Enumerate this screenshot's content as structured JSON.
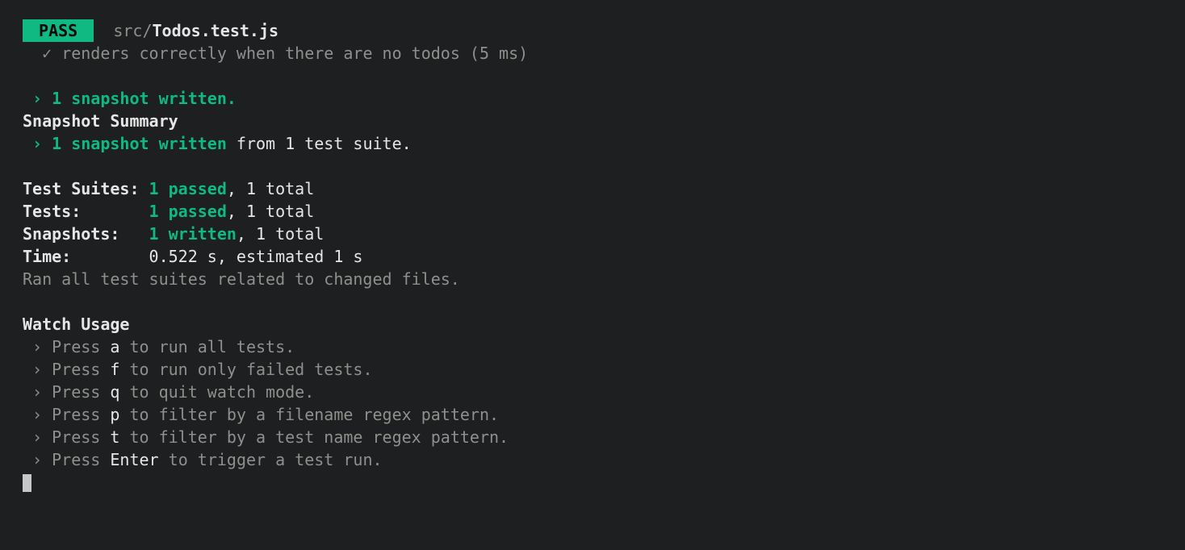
{
  "pass_badge": " PASS ",
  "file_path_dim": "src/",
  "file_path_bold": "Todos.test.js",
  "test_line_check": "✓",
  "test_line_text": "renders correctly when there are no todos (5 ms)",
  "snapshot": {
    "arrow": "›",
    "written_text": "1 snapshot written.",
    "summary_heading": "Snapshot Summary",
    "summary_arrow": "›",
    "summary_green": "1 snapshot written",
    "summary_rest": " from 1 test suite."
  },
  "results": {
    "suites_label": "Test Suites: ",
    "suites_green": "1 passed",
    "suites_rest": ", 1 total",
    "tests_label": "Tests:       ",
    "tests_green": "1 passed",
    "tests_rest": ", 1 total",
    "snapshots_label": "Snapshots:   ",
    "snapshots_green": "1 written",
    "snapshots_rest": ", 1 total",
    "time_label": "Time:",
    "time_value": "        0.522 s, estimated 1 s",
    "ran_note": "Ran all test suites related to changed files."
  },
  "watch": {
    "heading": "Watch Usage",
    "items": [
      {
        "pre": "Press ",
        "key": "a",
        "post": " to run all tests."
      },
      {
        "pre": "Press ",
        "key": "f",
        "post": " to run only failed tests."
      },
      {
        "pre": "Press ",
        "key": "q",
        "post": " to quit watch mode."
      },
      {
        "pre": "Press ",
        "key": "p",
        "post": " to filter by a filename regex pattern."
      },
      {
        "pre": "Press ",
        "key": "t",
        "post": " to filter by a test name regex pattern."
      },
      {
        "pre": "Press ",
        "key": "Enter",
        "post": " to trigger a test run."
      }
    ],
    "arrow": "›"
  }
}
